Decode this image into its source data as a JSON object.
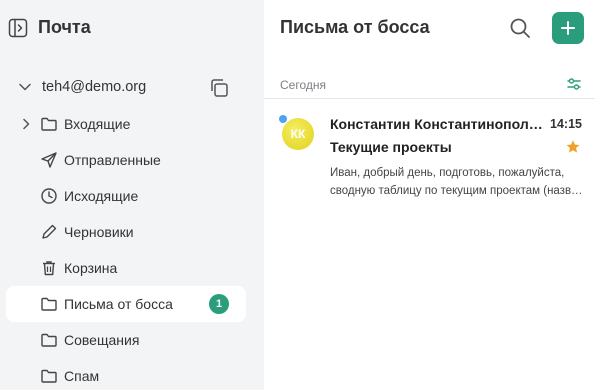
{
  "sidebar": {
    "title": "Почта",
    "account": {
      "email": "teh4@demo.org"
    },
    "folders": [
      {
        "label": "Входящие",
        "icon": "folder-icon",
        "expandable": true
      },
      {
        "label": "Отправленные",
        "icon": "send-icon"
      },
      {
        "label": "Исходящие",
        "icon": "clock-icon"
      },
      {
        "label": "Черновики",
        "icon": "pencil-icon"
      },
      {
        "label": "Корзина",
        "icon": "trash-icon"
      },
      {
        "label": "Письма от босса",
        "icon": "folder-icon",
        "active": true,
        "badge": "1"
      },
      {
        "label": "Совещания",
        "icon": "folder-icon"
      },
      {
        "label": "Спам",
        "icon": "folder-icon"
      }
    ]
  },
  "main": {
    "title": "Письма от босса",
    "group_label": "Сегодня",
    "messages": [
      {
        "initials": "КК",
        "sender": "Константин Константинопольский",
        "time": "14:15",
        "subject": "Текущие проекты",
        "preview_line1": "Иван, добрый день, подготовь, пожалуйста,",
        "preview_line2": "сводную таблицу по текущим проектам (название",
        "unread": true,
        "starred": true
      }
    ]
  },
  "colors": {
    "accent": "#2a9d7d",
    "unread_dot": "#4ca3ef",
    "star": "#f0a12b",
    "avatar": "#e8d92a",
    "sidebar_bg": "#f3f4f6"
  }
}
